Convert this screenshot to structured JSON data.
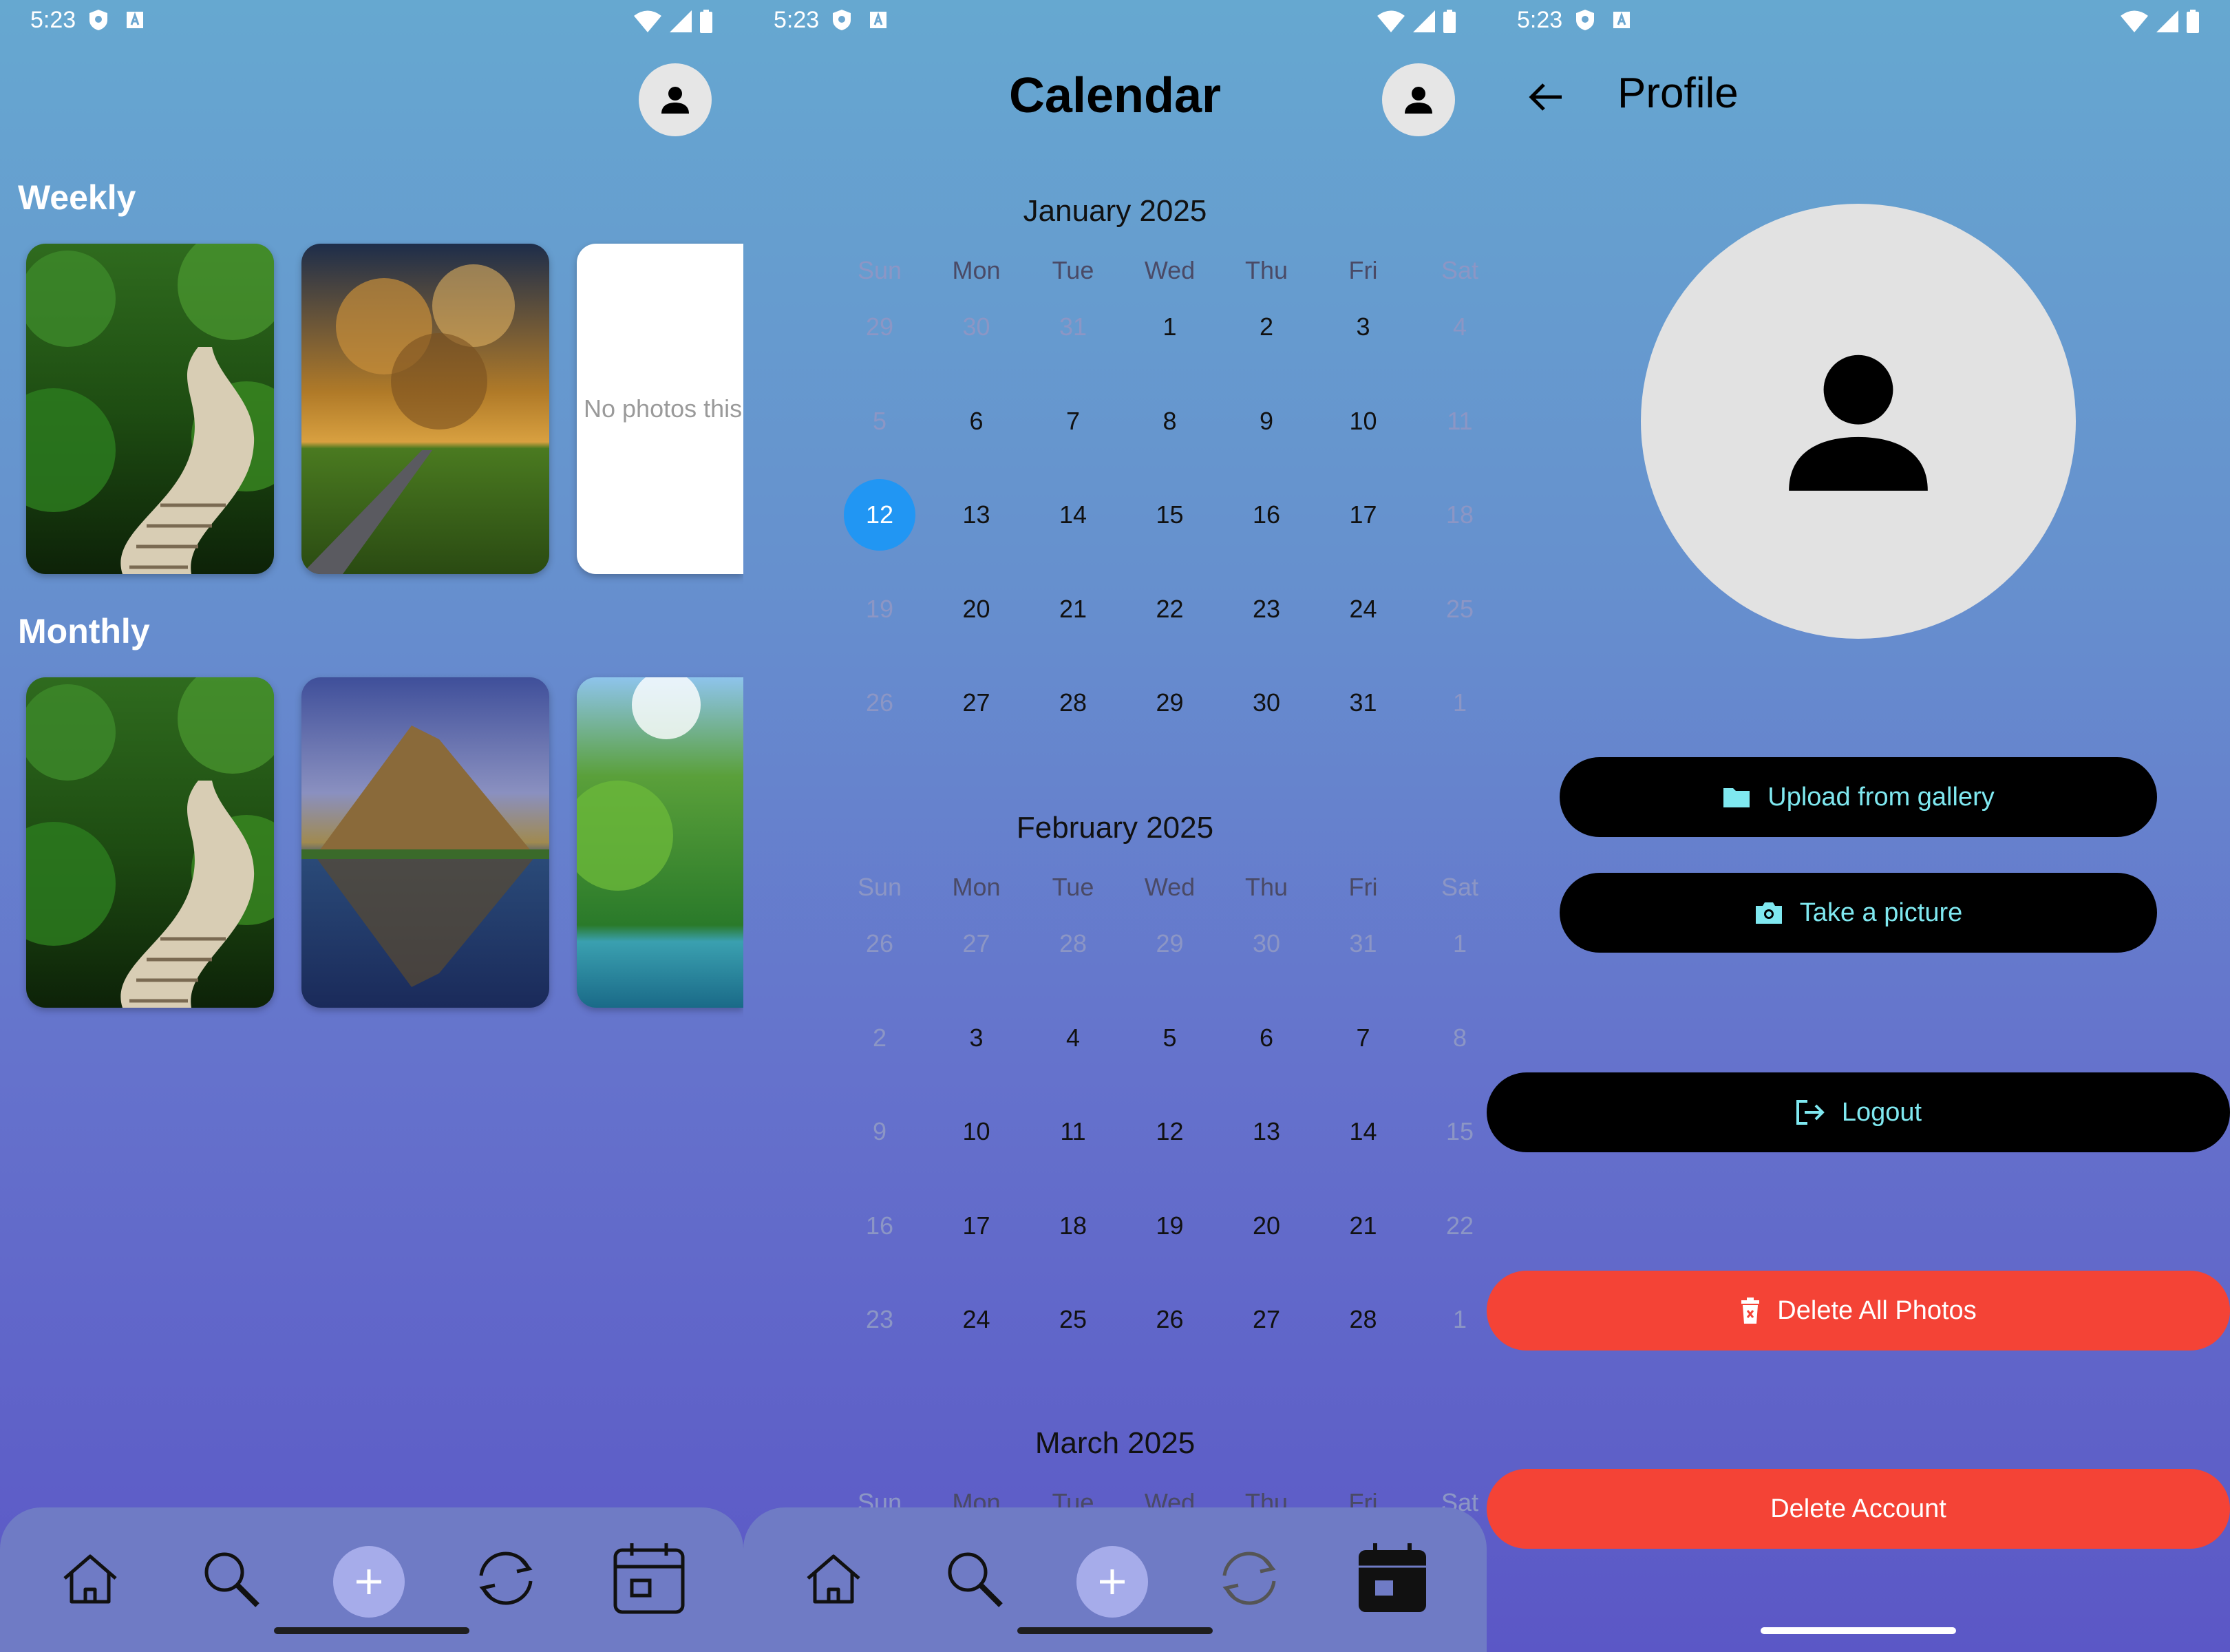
{
  "status": {
    "time": "5:23"
  },
  "home": {
    "weekly_title": "Weekly",
    "monthly_title": "Monthly",
    "weekly_photos": [
      {
        "kind": "image",
        "scene": "forest boardwalk"
      },
      {
        "kind": "image",
        "scene": "clouds over road"
      },
      {
        "kind": "empty",
        "text": "No photos this"
      }
    ],
    "monthly_photos": [
      {
        "kind": "image",
        "scene": "forest boardwalk"
      },
      {
        "kind": "image",
        "scene": "mountain reflection"
      },
      {
        "kind": "image",
        "scene": "lake and trees"
      }
    ]
  },
  "calendar": {
    "title": "Calendar",
    "weekdays": [
      "Sun",
      "Mon",
      "Tue",
      "Wed",
      "Thu",
      "Fri",
      "Sat"
    ],
    "months": [
      {
        "title": "January 2025",
        "weeks": [
          [
            "29",
            "30",
            "31",
            "1",
            "2",
            "3",
            "4"
          ],
          [
            "5",
            "6",
            "7",
            "8",
            "9",
            "10",
            "11"
          ],
          [
            "12",
            "13",
            "14",
            "15",
            "16",
            "17",
            "18"
          ],
          [
            "19",
            "20",
            "21",
            "22",
            "23",
            "24",
            "25"
          ],
          [
            "26",
            "27",
            "28",
            "29",
            "30",
            "31",
            "1"
          ]
        ],
        "muted": [
          [
            0,
            0
          ],
          [
            0,
            1
          ],
          [
            0,
            2
          ],
          [
            0,
            6
          ],
          [
            1,
            0
          ],
          [
            1,
            6
          ],
          [
            2,
            6
          ],
          [
            3,
            0
          ],
          [
            3,
            6
          ],
          [
            4,
            0
          ],
          [
            4,
            6
          ]
        ],
        "selected": [
          2,
          0
        ]
      },
      {
        "title": "February 2025",
        "weeks": [
          [
            "26",
            "27",
            "28",
            "29",
            "30",
            "31",
            "1"
          ],
          [
            "2",
            "3",
            "4",
            "5",
            "6",
            "7",
            "8"
          ],
          [
            "9",
            "10",
            "11",
            "12",
            "13",
            "14",
            "15"
          ],
          [
            "16",
            "17",
            "18",
            "19",
            "20",
            "21",
            "22"
          ],
          [
            "23",
            "24",
            "25",
            "26",
            "27",
            "28",
            "1"
          ]
        ],
        "muted": [
          [
            0,
            0
          ],
          [
            0,
            1
          ],
          [
            0,
            2
          ],
          [
            0,
            3
          ],
          [
            0,
            4
          ],
          [
            0,
            5
          ],
          [
            0,
            6
          ],
          [
            1,
            0
          ],
          [
            1,
            6
          ],
          [
            2,
            0
          ],
          [
            2,
            6
          ],
          [
            3,
            0
          ],
          [
            3,
            6
          ],
          [
            4,
            0
          ],
          [
            4,
            6
          ]
        ],
        "selected": null
      },
      {
        "title": "March 2025",
        "weeks": [],
        "muted": [],
        "selected": null
      }
    ]
  },
  "profile": {
    "title": "Profile",
    "upload_label": "Upload from gallery",
    "take_picture_label": "Take a picture",
    "logout_label": "Logout",
    "delete_photos_label": "Delete All Photos",
    "delete_account_label": "Delete Account"
  },
  "colors": {
    "accent": "#2196f3",
    "danger": "#f44336",
    "button_text": "#7fe8f0"
  },
  "nav": {
    "items": [
      "home-icon",
      "search-icon",
      "add-icon",
      "sync-icon",
      "calendar-icon"
    ]
  }
}
